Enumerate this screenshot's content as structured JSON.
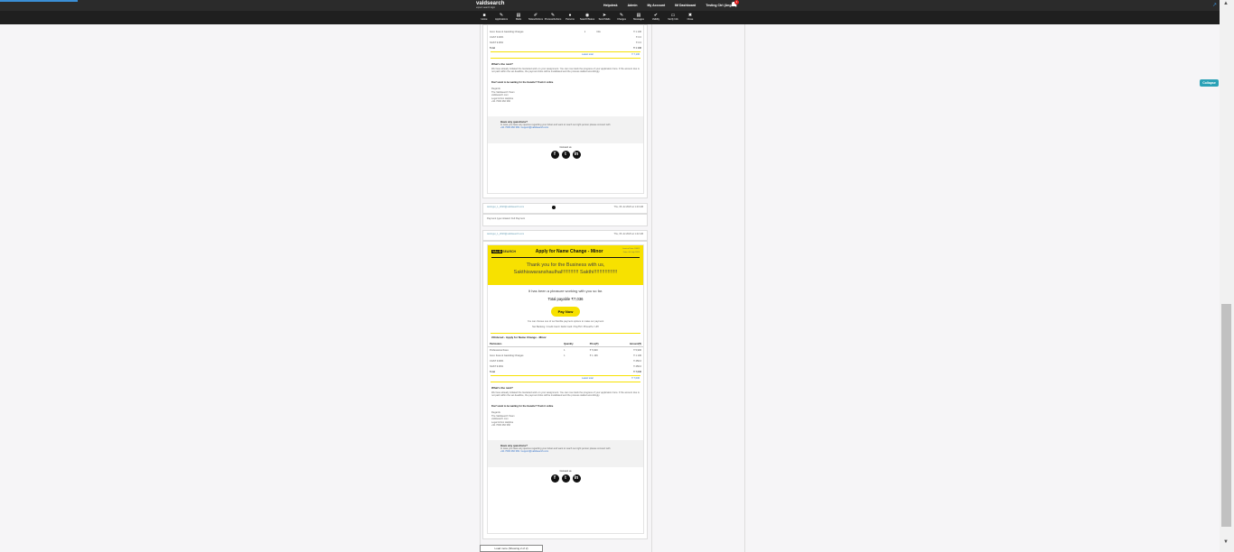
{
  "app": {
    "logo": "valdsearch",
    "logo_tagline": "expert search logic"
  },
  "topnav": {
    "links": [
      "Helpdesk",
      "Admin",
      "My Account",
      "IM Dashboard",
      "Testing Ctrl (Angela)"
    ],
    "notification_count": "1"
  },
  "toolbar": {
    "tools": [
      {
        "icon": "square-icon",
        "glyph": "■",
        "label": "Home"
      },
      {
        "icon": "pen-icon",
        "glyph": "✎",
        "label": "Applications"
      },
      {
        "icon": "file-icon",
        "glyph": "▤",
        "label": "Mails"
      },
      {
        "icon": "edit-icon",
        "glyph": "✐",
        "label": "Notes/Actions"
      },
      {
        "icon": "pencil-icon",
        "glyph": "✎",
        "label": "Process/Actions"
      },
      {
        "icon": "user-icon",
        "glyph": "●",
        "label": "Persons"
      },
      {
        "icon": "circle-icon",
        "glyph": "◉",
        "label": "Search/Status"
      },
      {
        "icon": "send-icon",
        "glyph": "➤",
        "label": "Send Mails"
      },
      {
        "icon": "tag-icon",
        "glyph": "✎",
        "label": "Charges"
      },
      {
        "icon": "mail-icon",
        "glyph": "▤",
        "label": "Messages"
      },
      {
        "icon": "check-icon",
        "glyph": "✔",
        "label": "Validity"
      },
      {
        "icon": "screen-icon",
        "glyph": "▭",
        "label": "Verify Info"
      },
      {
        "icon": "close-icon",
        "glyph": "✖",
        "label": "Close"
      }
    ]
  },
  "email1": {
    "rows": [
      {
        "desc": "Govt. Fees & Gazetting Charges",
        "qty": "1",
        "price": "N/A",
        "amount": "₹ 1 136"
      },
      {
        "desc": "CGST 9.00%",
        "qty": "",
        "price": "",
        "amount": "₹ 0 0"
      },
      {
        "desc": "SGST 9.00%",
        "qty": "",
        "price": "",
        "amount": "₹ 0 0"
      },
      {
        "desc": "Total",
        "qty": "",
        "price": "",
        "amount": "₹ 1 136"
      }
    ],
    "balance_label": "Latest total",
    "balance_value": "₹ 7,136",
    "whats_next_title": "What's the next?",
    "whats_next_text": "We have already initiated the Gazetted work on your assignment. You can now track the progress of your application here. If the amount due is not paid within the set deadline, the payment links will be invalidated and the process stalled accordingly.",
    "certify_title": "Don't want to be waiting for the Gazette? Track it online",
    "address": [
      "Regards",
      "The Validsearch Team",
      "validsearch.com",
      "Legal & Doc Helpline",
      "+91 7000 260 360"
    ],
    "questions_title": "Have any questions?",
    "questions_text": "In case you have any queries regarding your ticket and want to reach out right person please connect with",
    "contact_text": "+91 7000 260 360 / support@validsearch.com",
    "connect_label": "Connect us"
  },
  "activity": {
    "author": "testingui_1_2020@validsearch.com",
    "timestamp": "Thu, 06 Jul 2023 at 1:43 AM",
    "payment_note": "Payment type initiated: Full Payment"
  },
  "activity2": {
    "author": "testingui_1_2020@validsearch.com",
    "timestamp": "Thu, 06 Jul 2023 at 1:42 AM"
  },
  "email2": {
    "brand_left": "VALID",
    "brand_right": "SEARCH",
    "subject": "Apply for Name Change - Minor",
    "invoice_no": "Invoice Date #0001",
    "invoice_date": "Date: 06 July 2023",
    "thanks_line1": "Thank you for the Business with us,",
    "thanks_line2": "Sakthiswaranshaulhal!!!!!!!!!!!! Sakthi!!!!!!!!!!!!!!!!!",
    "pleasure": "It has been a pleasure working with you so far.",
    "total_payable": "Total payable ₹7,036",
    "pay_now": "Pay Now",
    "payment_options_text": "You can choose one of our flexible payment options to make our payment",
    "payment_methods": "Net Banking / Credit Card / Debit Card / PayTM / PhonePe / UPI",
    "order_title": "#Ordered - Apply for Name Change - Minor",
    "table_headers": [
      "Particulars",
      "Quantity",
      "Price(₹)",
      "Amount(₹)"
    ],
    "rows": [
      {
        "desc": "Professional Fees",
        "qty": "1",
        "price": "₹ 5,900",
        "amount": "₹ 5,900"
      },
      {
        "desc": "Govt. Fees & Gazetting Charges",
        "qty": "1",
        "price": "₹ 1 136",
        "amount": "₹ 1 136"
      },
      {
        "desc": "CGST 9.00%",
        "qty": "",
        "price": "",
        "amount": "₹ 450.0"
      },
      {
        "desc": "SGST 9.00%",
        "qty": "",
        "price": "",
        "amount": "₹ 450.0"
      },
      {
        "desc": "Total",
        "qty": "",
        "price": "",
        "amount": "₹ 7,036"
      }
    ],
    "balance_label": "Latest total",
    "balance_value": "₹ 7,036",
    "whats_next_title": "What's the next?",
    "whats_next_text": "We have already initiated the Gazetted work on your assignment. You can now track the progress of your application here. If the amount due is not paid within the set deadline, the payment links will be invalidated and the process stalled accordingly.",
    "certify_title": "Don't want to be waiting for the Gazette? Track it online",
    "address": [
      "Regards",
      "The Validsearch Team",
      "validsearch.com",
      "Legal & Doc Helpline",
      "+91 7000 260 360"
    ],
    "questions_title": "Have any questions?",
    "questions_text": "In case you have any queries regarding your ticket and want to reach out right person please connect with",
    "contact_text": "+91 7000 260 360 / support@validsearch.com",
    "connect_label": "Connect us"
  },
  "sidebar_right": {
    "collapse_label": "Collapse"
  },
  "footer_button": "Load more (Showing 2 of 2)",
  "colors": {
    "accent": "#f7e100",
    "topbar": "#2b2b2b",
    "collapse": "#2ba1b6",
    "link": "#3070c8"
  }
}
